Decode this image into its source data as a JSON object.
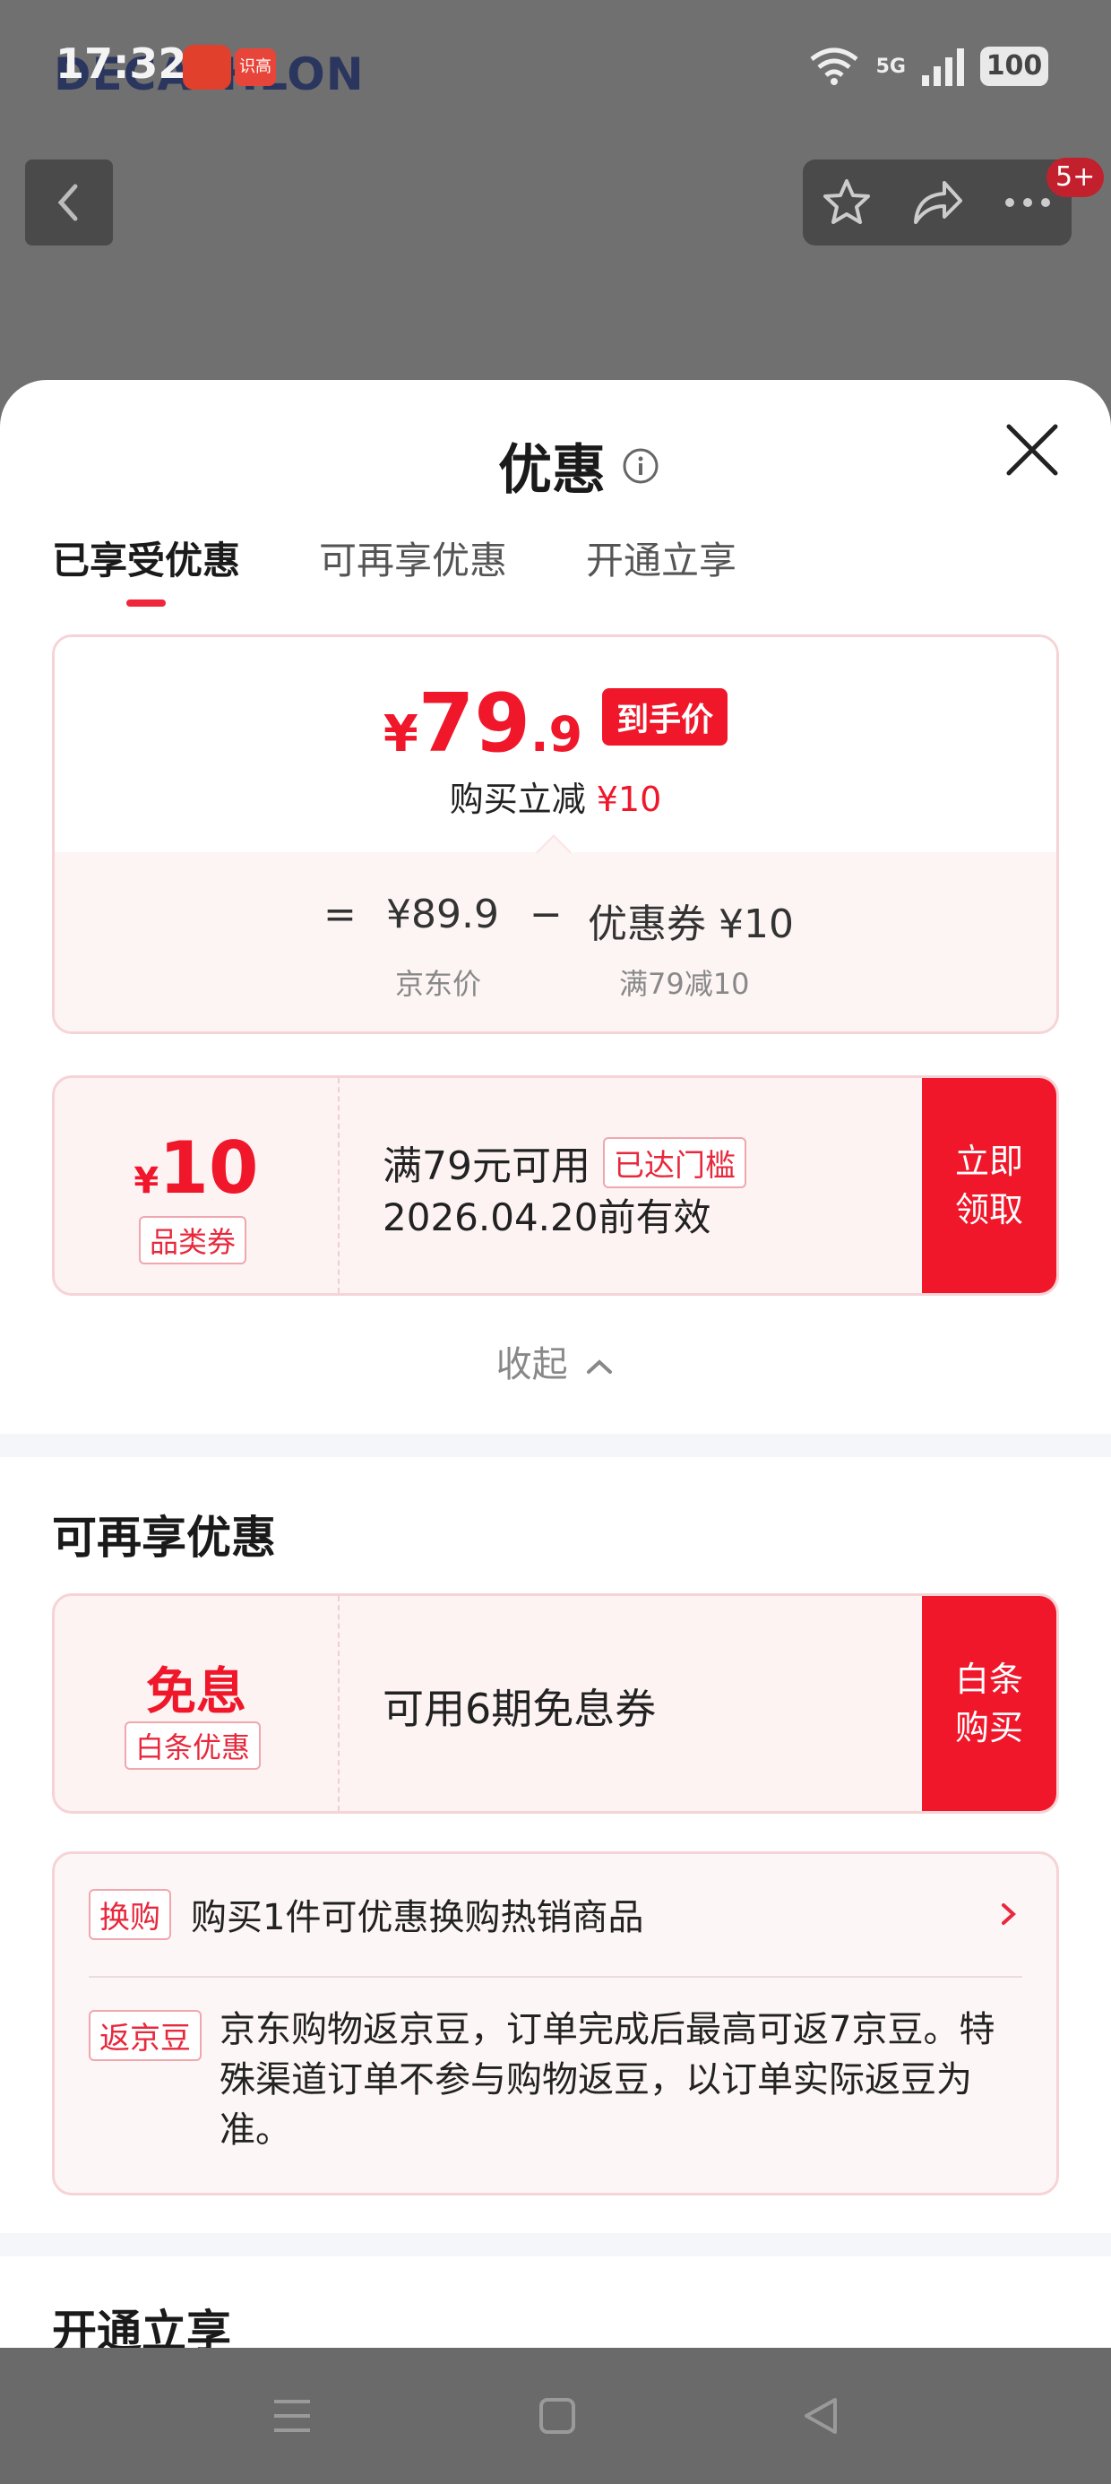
{
  "status_bar": {
    "time": "17:32",
    "app_badge": "识高",
    "network": "5G",
    "battery": "100"
  },
  "backdrop": {
    "brand": "DECATHLON",
    "notification_badge": "5+"
  },
  "sheet": {
    "title": "优惠",
    "tabs": [
      "已享受优惠",
      "可再享优惠",
      "开通立享"
    ],
    "active_tab": 0
  },
  "price_card": {
    "currency": "¥",
    "price_integer": "79",
    "price_decimal": ".9",
    "price_tag": "到手价",
    "reduce_label": "购买立减",
    "reduce_amount": "¥10",
    "equals": "=",
    "base_price": "¥89.9",
    "minus": "−",
    "coupon_label": "优惠券 ¥10",
    "base_price_caption": "京东价",
    "coupon_caption": "满79减10"
  },
  "category_coupon": {
    "currency": "¥",
    "amount": "10",
    "type": "品类券",
    "condition": "满79元可用",
    "condition_tag": "已达门槛",
    "validity": "2026.04.20前有效",
    "button": [
      "立即",
      "领取"
    ]
  },
  "collapse_label": "收起",
  "more_offers": {
    "section_title": "可再享优惠",
    "interest_free": {
      "word": "免息",
      "tag": "白条优惠",
      "text": "可用6期免息券",
      "button": [
        "白条",
        "购买"
      ]
    },
    "perks": [
      {
        "tag": "换购",
        "text": "购买1件可优惠换购热销商品"
      },
      {
        "tag": "返京豆",
        "text": "京东购物返京豆，订单完成后最高可返7京豆。特殊渠道订单不参与购物返豆，以订单实际返豆为准。"
      }
    ]
  },
  "join_section": {
    "section_title": "开通立享"
  },
  "colors": {
    "accent_red": "#f0172b",
    "card_border": "#f6d3d6",
    "card_bg": "#fdf3f3"
  }
}
